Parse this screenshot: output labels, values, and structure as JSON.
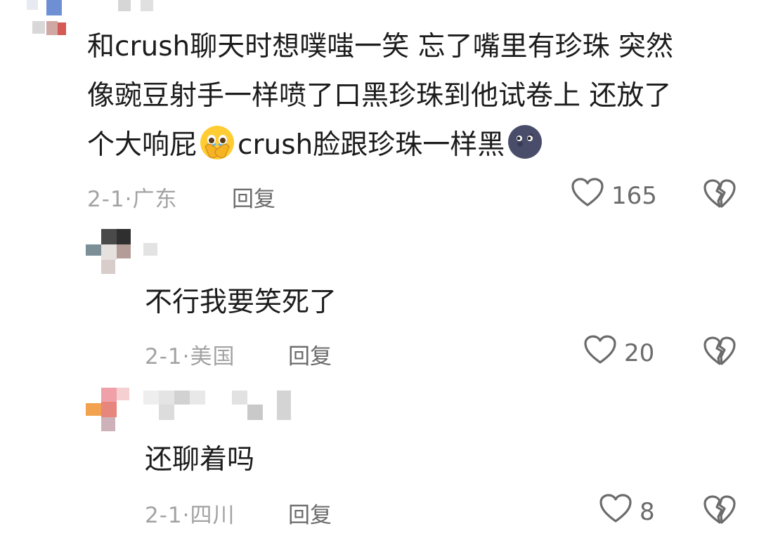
{
  "comments": [
    {
      "lines": [
        "和crush聊天时想噗嗤一笑 忘了嘴里有珍珠 突然",
        "像豌豆射手一样喷了口黑珍珠到他试卷上 还放了"
      ],
      "line3_a": "个大响屁",
      "line3_b": "crush脸跟珍珠一样黑",
      "emojis": [
        "face-holding-back-tears",
        "new-moon-face"
      ],
      "date": "2-1·",
      "location": "广东",
      "reply_label": "回复",
      "likes": "165"
    },
    {
      "text": "不行我要笑死了",
      "date": "2-1·",
      "location": "美国",
      "reply_label": "回复",
      "likes": "20"
    },
    {
      "text": "还聊着吗",
      "date": "2-1·",
      "location": "四川",
      "reply_label": "回复",
      "likes": "8"
    }
  ]
}
